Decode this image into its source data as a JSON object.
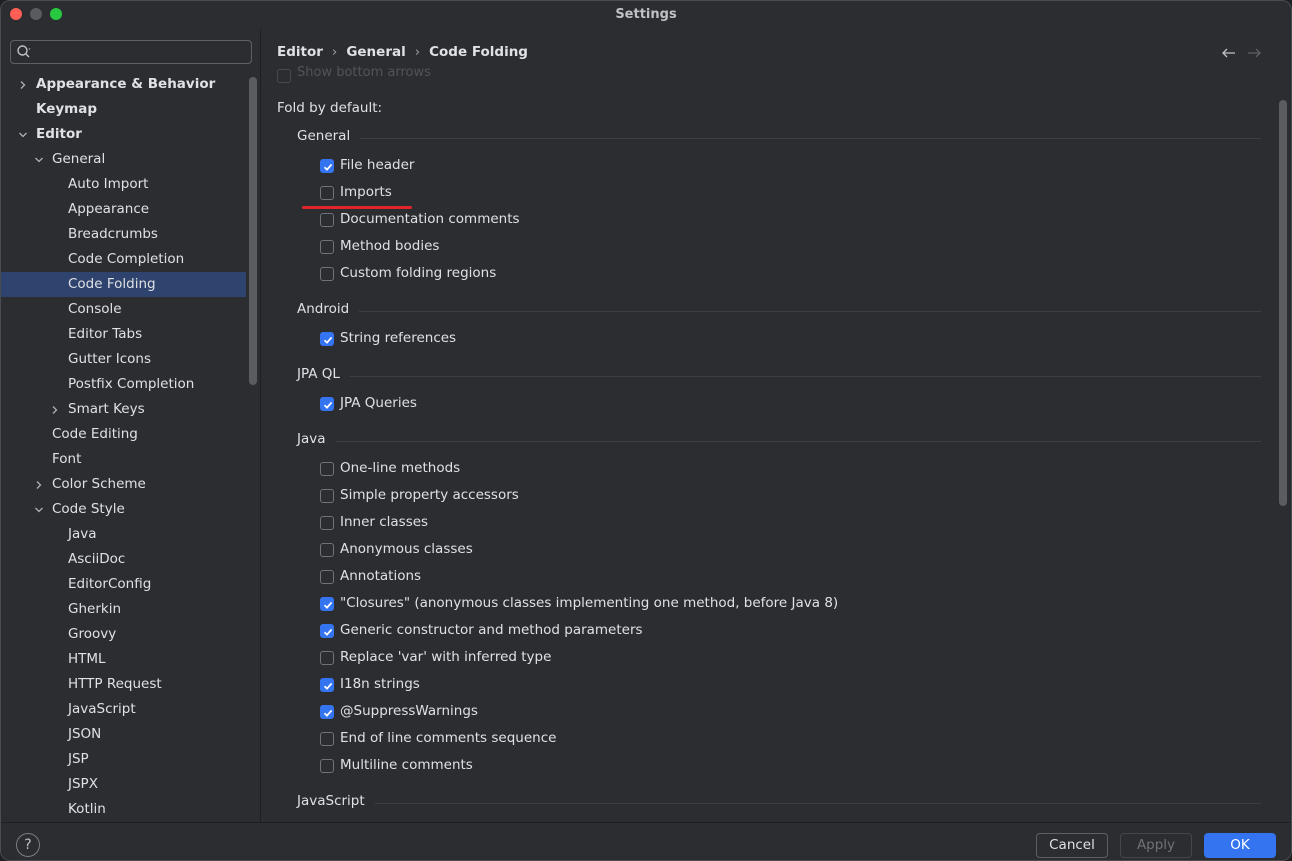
{
  "window": {
    "title": "Settings"
  },
  "search": {
    "placeholder": "",
    "value": ""
  },
  "sidebar": {
    "items": [
      {
        "label": "Appearance & Behavior",
        "level": 0,
        "expander": "collapsed",
        "bold": true,
        "selected": false
      },
      {
        "label": "Keymap",
        "level": 0,
        "expander": "none",
        "bold": true,
        "selected": false
      },
      {
        "label": "Editor",
        "level": 0,
        "expander": "expanded",
        "bold": true,
        "selected": false
      },
      {
        "label": "General",
        "level": 1,
        "expander": "expanded",
        "bold": false,
        "selected": false
      },
      {
        "label": "Auto Import",
        "level": 2,
        "expander": "none",
        "bold": false,
        "selected": false
      },
      {
        "label": "Appearance",
        "level": 2,
        "expander": "none",
        "bold": false,
        "selected": false
      },
      {
        "label": "Breadcrumbs",
        "level": 2,
        "expander": "none",
        "bold": false,
        "selected": false
      },
      {
        "label": "Code Completion",
        "level": 2,
        "expander": "none",
        "bold": false,
        "selected": false
      },
      {
        "label": "Code Folding",
        "level": 2,
        "expander": "none",
        "bold": false,
        "selected": true
      },
      {
        "label": "Console",
        "level": 2,
        "expander": "none",
        "bold": false,
        "selected": false
      },
      {
        "label": "Editor Tabs",
        "level": 2,
        "expander": "none",
        "bold": false,
        "selected": false
      },
      {
        "label": "Gutter Icons",
        "level": 2,
        "expander": "none",
        "bold": false,
        "selected": false
      },
      {
        "label": "Postfix Completion",
        "level": 2,
        "expander": "none",
        "bold": false,
        "selected": false
      },
      {
        "label": "Smart Keys",
        "level": 2,
        "expander": "collapsed",
        "bold": false,
        "selected": false
      },
      {
        "label": "Code Editing",
        "level": 1,
        "expander": "none",
        "bold": false,
        "selected": false
      },
      {
        "label": "Font",
        "level": 1,
        "expander": "none",
        "bold": false,
        "selected": false
      },
      {
        "label": "Color Scheme",
        "level": 1,
        "expander": "collapsed",
        "bold": false,
        "selected": false
      },
      {
        "label": "Code Style",
        "level": 1,
        "expander": "expanded",
        "bold": false,
        "selected": false
      },
      {
        "label": "Java",
        "level": 2,
        "expander": "none",
        "bold": false,
        "selected": false
      },
      {
        "label": "AsciiDoc",
        "level": 2,
        "expander": "none",
        "bold": false,
        "selected": false
      },
      {
        "label": "EditorConfig",
        "level": 2,
        "expander": "none",
        "bold": false,
        "selected": false
      },
      {
        "label": "Gherkin",
        "level": 2,
        "expander": "none",
        "bold": false,
        "selected": false
      },
      {
        "label": "Groovy",
        "level": 2,
        "expander": "none",
        "bold": false,
        "selected": false
      },
      {
        "label": "HTML",
        "level": 2,
        "expander": "none",
        "bold": false,
        "selected": false
      },
      {
        "label": "HTTP Request",
        "level": 2,
        "expander": "none",
        "bold": false,
        "selected": false
      },
      {
        "label": "JavaScript",
        "level": 2,
        "expander": "none",
        "bold": false,
        "selected": false
      },
      {
        "label": "JSON",
        "level": 2,
        "expander": "none",
        "bold": false,
        "selected": false
      },
      {
        "label": "JSP",
        "level": 2,
        "expander": "none",
        "bold": false,
        "selected": false
      },
      {
        "label": "JSPX",
        "level": 2,
        "expander": "none",
        "bold": false,
        "selected": false
      },
      {
        "label": "Kotlin",
        "level": 2,
        "expander": "none",
        "bold": false,
        "selected": false
      }
    ]
  },
  "breadcrumb": [
    "Editor",
    "General",
    "Code Folding"
  ],
  "content": {
    "scrolled_option": "Show bottom arrows",
    "fold_title": "Fold by default:",
    "groups": [
      {
        "label": "General",
        "options": [
          {
            "label": "File header",
            "checked": true
          },
          {
            "label": "Imports",
            "checked": false
          },
          {
            "label": "Documentation comments",
            "checked": false
          },
          {
            "label": "Method bodies",
            "checked": false
          },
          {
            "label": "Custom folding regions",
            "checked": false
          }
        ]
      },
      {
        "label": "Android",
        "options": [
          {
            "label": "String references",
            "checked": true
          }
        ]
      },
      {
        "label": "JPA QL",
        "options": [
          {
            "label": "JPA Queries",
            "checked": true
          }
        ]
      },
      {
        "label": "Java",
        "options": [
          {
            "label": "One-line methods",
            "checked": false
          },
          {
            "label": "Simple property accessors",
            "checked": false
          },
          {
            "label": "Inner classes",
            "checked": false
          },
          {
            "label": "Anonymous classes",
            "checked": false
          },
          {
            "label": "Annotations",
            "checked": false
          },
          {
            "label": "\"Closures\" (anonymous classes implementing one method, before Java 8)",
            "checked": true
          },
          {
            "label": "Generic constructor and method parameters",
            "checked": true
          },
          {
            "label": "Replace 'var' with inferred type",
            "checked": false
          },
          {
            "label": "I18n strings",
            "checked": true
          },
          {
            "label": "@SuppressWarnings",
            "checked": true
          },
          {
            "label": "End of line comments sequence",
            "checked": false
          },
          {
            "label": "Multiline comments",
            "checked": false
          }
        ]
      },
      {
        "label": "JavaScript",
        "options": []
      }
    ]
  },
  "footer": {
    "help_label": "?",
    "cancel_label": "Cancel",
    "apply_label": "Apply",
    "ok_label": "OK"
  },
  "colors": {
    "accent": "#3574f0",
    "selection": "#2e436e",
    "annotation": "#e0242a",
    "background": "#2b2d30"
  }
}
